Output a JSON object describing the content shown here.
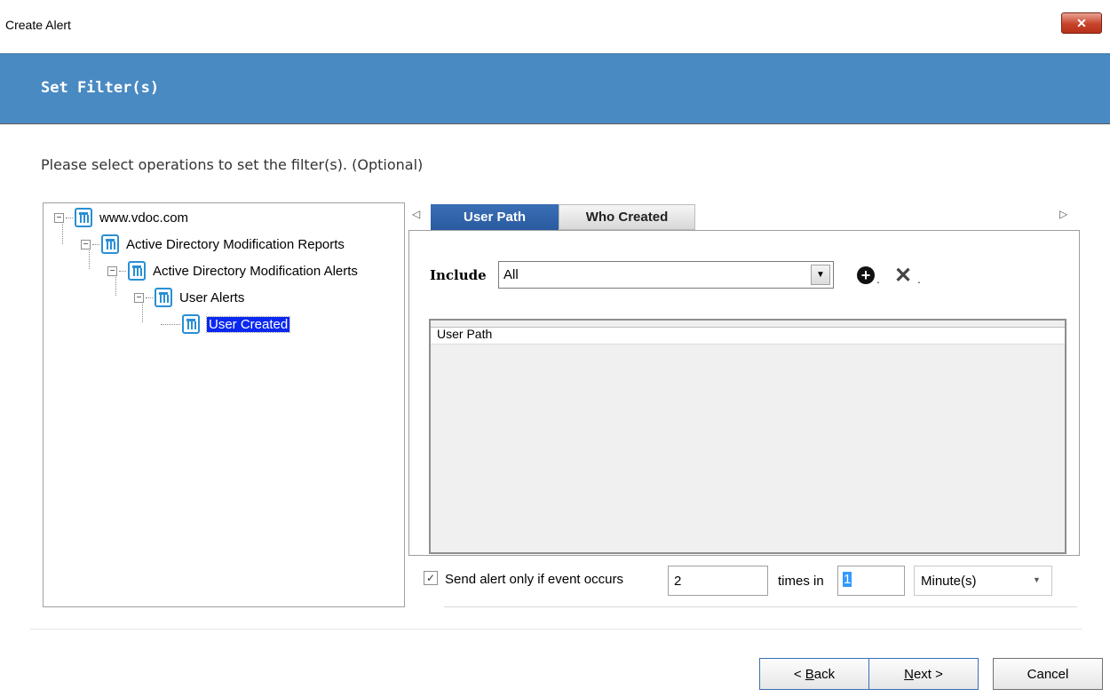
{
  "window": {
    "title": "Create Alert",
    "close_label": "✕"
  },
  "header": {
    "title": "Set Filter(s)"
  },
  "instruction": "Please select operations to set the filter(s). (Optional)",
  "tree": {
    "items": [
      {
        "label": "www.vdoc.com"
      },
      {
        "label": "Active Directory Modification Reports"
      },
      {
        "label": "Active Directory Modification Alerts"
      },
      {
        "label": "User Alerts"
      },
      {
        "label": "User Created",
        "selected": true
      }
    ]
  },
  "tabs": {
    "items": [
      {
        "label": "User Path",
        "active": true
      },
      {
        "label": "Who Created",
        "active": false
      }
    ],
    "left_arrow": "◁",
    "right_arrow": "▷"
  },
  "filter": {
    "include_label": "Include",
    "include_value": "All",
    "dropdown_arrow": "▼",
    "add_icon": "+",
    "remove_icon": "✕",
    "icon_suffix": "."
  },
  "list": {
    "column_header": "User Path"
  },
  "options": {
    "checkbox_checked": true,
    "checkbox_mark": "✓",
    "send_label": "Send alert only if event occurs",
    "times_value": "2",
    "times_in_label": "times in",
    "interval_value": "1",
    "unit_value": "Minute(s)",
    "unit_arrow": "▼"
  },
  "footer": {
    "back": {
      "mnemonic": "B",
      "pre": "< ",
      "rest": "ack"
    },
    "next": {
      "mnemonic": "N",
      "rest": "ext >"
    },
    "cancel": "Cancel"
  },
  "colors": {
    "header_bg": "#4a8ac2",
    "active_tab": "#2a5aa0",
    "selection": "#0a28f0",
    "icon_blue": "#2a8fd4"
  }
}
